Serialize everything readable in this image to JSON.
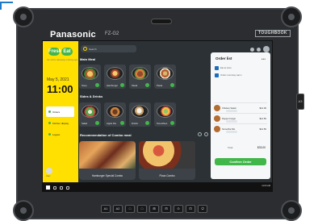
{
  "device": {
    "brand": "Panasonic",
    "model": "FZ-G2",
    "rugged_label": "TOUGHBOOK",
    "side_button": "A3",
    "hardware_buttons": [
      "A1",
      "A2",
      "□",
      "□",
      "⊞",
      "⊟",
      "⊙",
      "⊡",
      "⏻"
    ]
  },
  "app": {
    "logo_text": "Fresh",
    "logo_badge": "Eat",
    "tagline": "the online takeaway ordering app",
    "date": "May 5, 2021",
    "time": "11:00",
    "nav": [
      "Orders",
      "Kitchen display",
      "Logout"
    ],
    "user_label": "User"
  },
  "search": {
    "placeholder": "Search"
  },
  "sections": {
    "main": "Main Meal",
    "sides": "Sides & Drinks",
    "combo": "Recommendation of Combo meal"
  },
  "main_meals": [
    "Soup",
    "Hamburger",
    "Steak",
    "Pasta"
  ],
  "sides": [
    "Salad",
    "Apple Pie",
    "Drinks",
    "Smoothies"
  ],
  "combos": [
    "Hamburger Special Combo",
    "Pizza Combo"
  ],
  "order": {
    "title": "Order list",
    "options": [
      "Eat at store",
      "Order must stay warm"
    ],
    "items": [
      {
        "name": "Chicken Salad",
        "price": "$14.00"
      },
      {
        "name": "Pepper burger",
        "price": "$14.50"
      },
      {
        "name": "Smoothie Mix",
        "price": "$14.50"
      }
    ],
    "total_label": "Total",
    "total": "$33.00",
    "confirm": "Confirm Order"
  },
  "taskbar": {
    "clock": "11:00 AM"
  }
}
